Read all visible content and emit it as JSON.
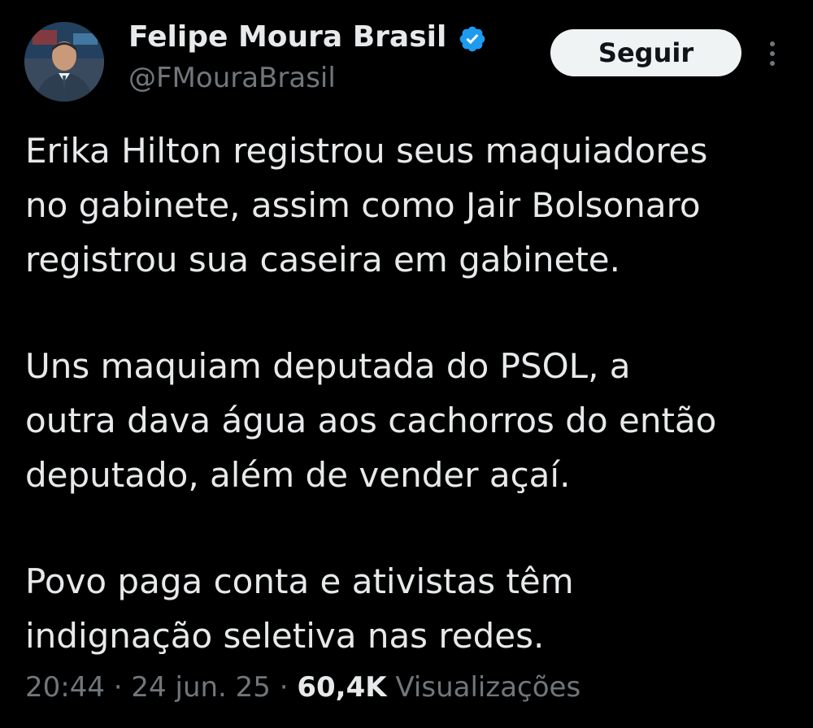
{
  "author": {
    "display_name": "Felipe Moura Brasil",
    "handle": "@FMouraBrasil",
    "verified": true
  },
  "follow_button": {
    "label": "Seguir"
  },
  "tweet": {
    "lines": [
      [
        "Erika Hilton registrou seus maquiadores",
        "no gabinete, assim como Jair Bolsonaro",
        "registrou sua caseira em gabinete."
      ],
      [
        "Uns maquiam deputada do PSOL, a",
        "outra dava água aos cachorros do então",
        "deputado, além de vender açaí."
      ],
      [
        "Povo paga conta e ativistas têm",
        "indignação seletiva nas redes."
      ]
    ]
  },
  "meta": {
    "time": "20:44",
    "separator": "·",
    "date": "24 jun. 25",
    "views_count": "60,4K",
    "views_label": "Visualizações"
  },
  "colors": {
    "background": "#000000",
    "primary_text": "#e7e9ea",
    "secondary_text": "#71767b",
    "verified_blue": "#1d9bf0",
    "button_bg": "#eff3f4"
  },
  "icons": {
    "verified": "verified-badge-icon",
    "more": "more-vertical-icon"
  }
}
